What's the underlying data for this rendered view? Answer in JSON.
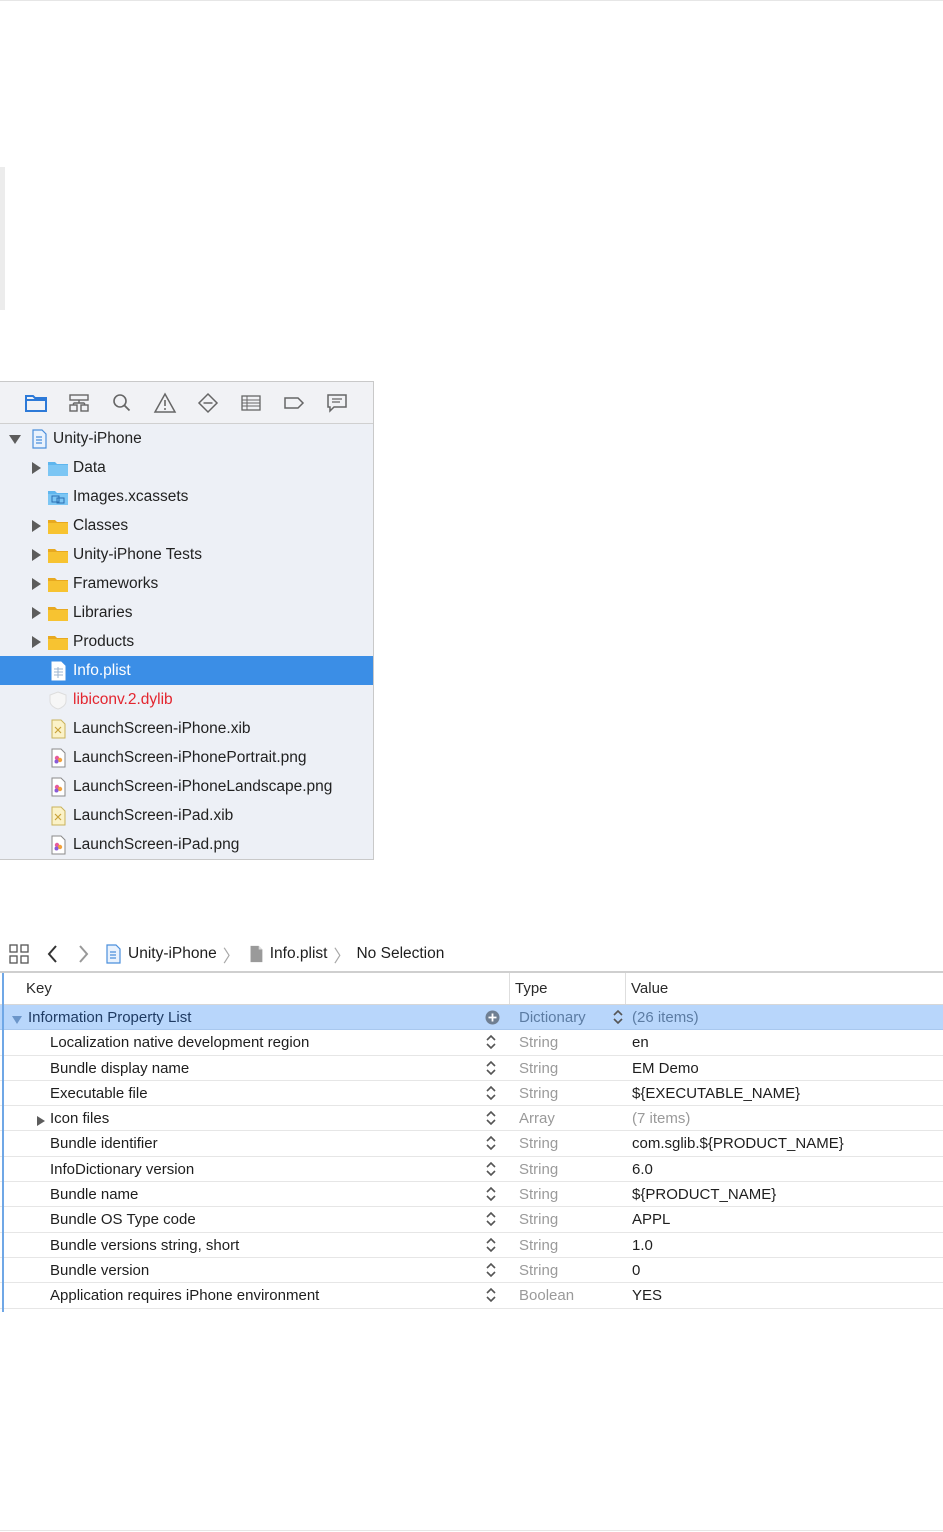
{
  "navigator": {
    "toolbar": [
      {
        "icon": "folder-icon"
      },
      {
        "icon": "hierarchy-icon"
      },
      {
        "icon": "search-icon"
      },
      {
        "icon": "warning-icon"
      },
      {
        "icon": "test-diamond-icon"
      },
      {
        "icon": "list-icon"
      },
      {
        "icon": "breakpoint-icon"
      },
      {
        "icon": "message-icon"
      }
    ],
    "tree": [
      {
        "label": "Unity-iPhone",
        "icon": "project-file-icon",
        "depth": 0,
        "disclosure": "open"
      },
      {
        "label": "Data",
        "icon": "blue-folder-icon",
        "depth": 1,
        "disclosure": "closed"
      },
      {
        "label": "Images.xcassets",
        "icon": "asset-catalog-icon",
        "depth": 1,
        "disclosure": "none"
      },
      {
        "label": "Classes",
        "icon": "yellow-folder-icon",
        "depth": 1,
        "disclosure": "closed"
      },
      {
        "label": "Unity-iPhone Tests",
        "icon": "yellow-folder-icon",
        "depth": 1,
        "disclosure": "closed"
      },
      {
        "label": "Frameworks",
        "icon": "yellow-folder-icon",
        "depth": 1,
        "disclosure": "closed"
      },
      {
        "label": "Libraries",
        "icon": "yellow-folder-icon",
        "depth": 1,
        "disclosure": "closed"
      },
      {
        "label": "Products",
        "icon": "yellow-folder-icon",
        "depth": 1,
        "disclosure": "closed"
      },
      {
        "label": "Info.plist",
        "icon": "plist-file-icon",
        "depth": 1,
        "disclosure": "none",
        "selected": true
      },
      {
        "label": "libiconv.2.dylib",
        "icon": "library-icon",
        "depth": 1,
        "disclosure": "none",
        "missing": true
      },
      {
        "label": "LaunchScreen-iPhone.xib",
        "icon": "xib-file-icon",
        "depth": 1,
        "disclosure": "none"
      },
      {
        "label": "LaunchScreen-iPhonePortrait.png",
        "icon": "image-file-icon",
        "depth": 1,
        "disclosure": "none"
      },
      {
        "label": "LaunchScreen-iPhoneLandscape.png",
        "icon": "image-file-icon",
        "depth": 1,
        "disclosure": "none"
      },
      {
        "label": "LaunchScreen-iPad.xib",
        "icon": "xib-file-icon",
        "depth": 1,
        "disclosure": "none"
      },
      {
        "label": "LaunchScreen-iPad.png",
        "icon": "image-file-icon",
        "depth": 1,
        "disclosure": "none"
      }
    ]
  },
  "editor": {
    "jumpbar": {
      "grid_icon": "related-items-icon",
      "back_icon": "back-chevron-icon",
      "forward_icon": "forward-chevron-icon",
      "crumbs": [
        {
          "label": "Unity-iPhone",
          "icon": "project-file-icon"
        },
        {
          "label": "Info.plist",
          "icon": "document-icon"
        },
        {
          "label": "No Selection",
          "icon": ""
        }
      ]
    },
    "columns": {
      "key": "Key",
      "type": "Type",
      "value": "Value"
    },
    "rows": [
      {
        "key": "Information Property List",
        "type": "Dictionary",
        "value": "(26 items)",
        "root": true,
        "muted": true
      },
      {
        "key": "Localization native development region",
        "type": "String",
        "value": "en"
      },
      {
        "key": "Bundle display name",
        "type": "String",
        "value": "EM Demo"
      },
      {
        "key": "Executable file",
        "type": "String",
        "value": "${EXECUTABLE_NAME}"
      },
      {
        "key": "Icon files",
        "type": "Array",
        "value": "(7 items)",
        "collapsed": true,
        "muted": true
      },
      {
        "key": "Bundle identifier",
        "type": "String",
        "value": "com.sglib.${PRODUCT_NAME}"
      },
      {
        "key": "InfoDictionary version",
        "type": "String",
        "value": "6.0"
      },
      {
        "key": "Bundle name",
        "type": "String",
        "value": "${PRODUCT_NAME}"
      },
      {
        "key": "Bundle OS Type code",
        "type": "String",
        "value": "APPL"
      },
      {
        "key": "Bundle versions string, short",
        "type": "String",
        "value": "1.0"
      },
      {
        "key": "Bundle version",
        "type": "String",
        "value": "0"
      },
      {
        "key": "Application requires iPhone environment",
        "type": "Boolean",
        "value": "YES"
      }
    ]
  },
  "colors": {
    "selection": "#3b8ee6",
    "root_row": "#b8d6fb",
    "missing": "#e3262f",
    "folder_yellow": "#f7c331",
    "folder_blue": "#5fb6ee"
  }
}
